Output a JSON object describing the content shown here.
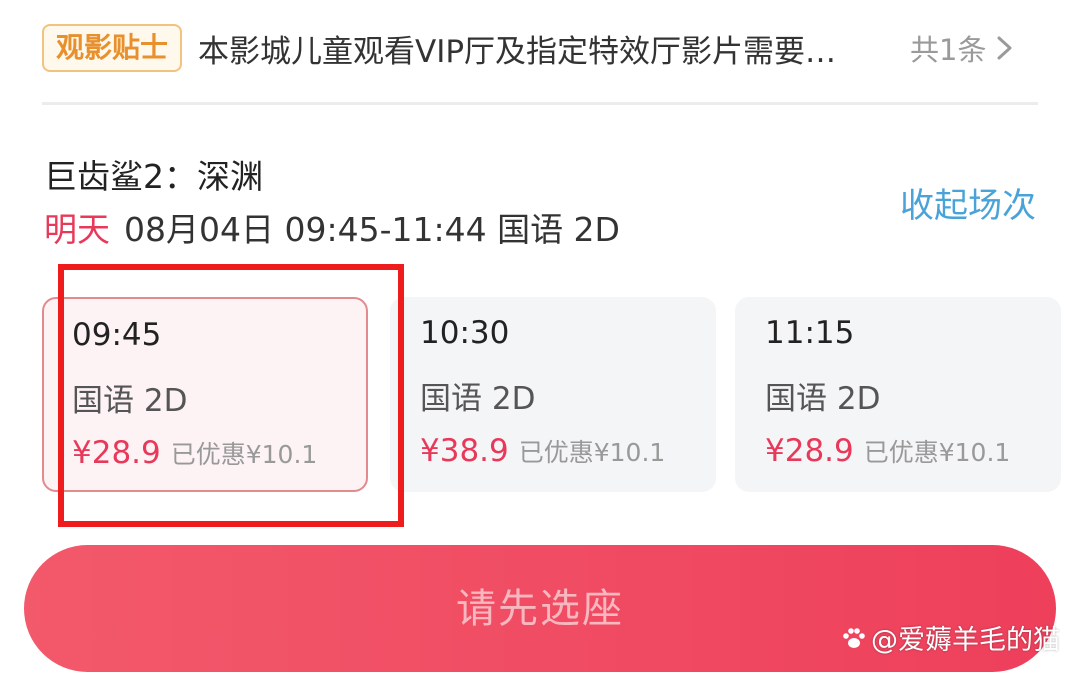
{
  "notice": {
    "tag_label": "观影贴士",
    "text": "本影城儿童观看VIP厅及指定特效厅影片需要…",
    "count_label": "共1条",
    "icon": "chevron-right-icon"
  },
  "movie": {
    "title": "巨齿鲨2：深渊",
    "day_label": "明天",
    "session_detail": "08月04日 09:45-11:44 国语 2D",
    "collapse_label": "收起场次"
  },
  "showtimes": [
    {
      "time": "09:45",
      "lang": "国语 2D",
      "price": "¥28.9",
      "discount": "已优惠¥10.1",
      "selected": true
    },
    {
      "time": "10:30",
      "lang": "国语 2D",
      "price": "¥38.9",
      "discount": "已优惠¥10.1",
      "selected": false
    },
    {
      "time": "11:15",
      "lang": "国语 2D",
      "price": "¥28.9",
      "discount": "已优惠¥10.1",
      "selected": false
    }
  ],
  "action": {
    "select_seat_label": "请先选座"
  },
  "watermark": {
    "text": "@爱薅羊毛的猫",
    "icon": "paw-icon"
  },
  "colors": {
    "accent_red": "#e8395a",
    "link_blue": "#4aa3d8",
    "tag_orange": "#e8902c",
    "annotation_red": "#ee1c1c"
  }
}
